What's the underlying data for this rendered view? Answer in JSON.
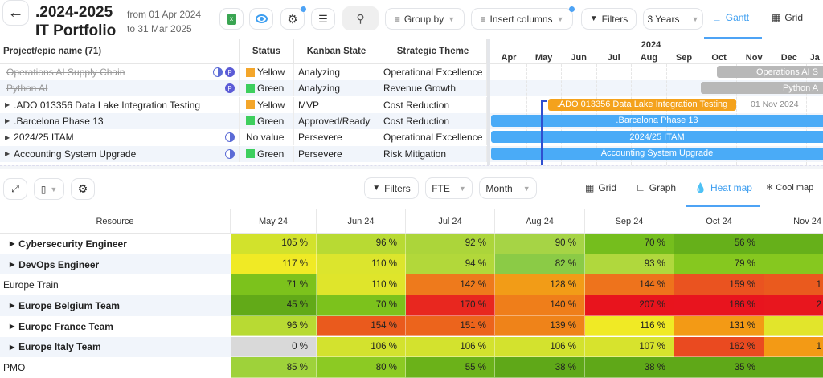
{
  "header": {
    "title_line1": ".2024-2025",
    "title_line2": "IT Portfolio",
    "date_from": "from 01 Apr 2024",
    "date_to": "to 31 Mar 2025"
  },
  "toolbar": {
    "group_by": "Group by",
    "insert_columns": "Insert columns",
    "filters": "Filters",
    "range": "3 Years",
    "tab_gantt": "Gantt",
    "tab_grid": "Grid"
  },
  "grid": {
    "columns": [
      "Project/epic name (71)",
      "Status",
      "Kanban State",
      "Strategic Theme"
    ],
    "rows": [
      {
        "name": "Operations AI Supply Chain",
        "struck": true,
        "expand": false,
        "icons": [
          "half-circle",
          "P"
        ],
        "status": "Yellow",
        "status_color": "#f4a62a",
        "kanban": "Analyzing",
        "theme": "Operational Excellence"
      },
      {
        "name": "Python AI",
        "struck": true,
        "expand": false,
        "icons": [
          "P"
        ],
        "status": "Green",
        "status_color": "#3ecf5e",
        "kanban": "Analyzing",
        "theme": "Revenue Growth"
      },
      {
        "name": ".ADO 013356 Data Lake Integration Testing",
        "struck": false,
        "expand": true,
        "icons": [],
        "status": "Yellow",
        "status_color": "#f4a62a",
        "kanban": "MVP",
        "theme": "Cost Reduction"
      },
      {
        "name": ".Barcelona Phase 13",
        "struck": false,
        "expand": true,
        "icons": [],
        "status": "Green",
        "status_color": "#3ecf5e",
        "kanban": "Approved/Ready",
        "theme": "Cost Reduction"
      },
      {
        "name": "2024/25 ITAM",
        "struck": false,
        "expand": true,
        "icons": [
          "half-circle"
        ],
        "status": "No value",
        "status_color": "",
        "kanban": "Persevere",
        "theme": "Operational Excellence"
      },
      {
        "name": "Accounting System Upgrade",
        "struck": false,
        "expand": true,
        "icons": [
          "half-circle"
        ],
        "status": "Green",
        "status_color": "#3ecf5e",
        "kanban": "Persevere",
        "theme": "Risk Mitigation"
      }
    ]
  },
  "gantt": {
    "year": "2024",
    "months": [
      "Apr",
      "May",
      "Jun",
      "Jul",
      "Aug",
      "Sep",
      "Oct",
      "Nov",
      "Dec",
      "Ja"
    ],
    "bars": [
      {
        "label": "Operations AI S",
        "color": "#b8b8b8",
        "start": "Oct",
        "row": 0
      },
      {
        "label": "Python A",
        "color": "#b8b8b8",
        "start": "Oct",
        "row": 1
      },
      {
        "label": ".ADO 013356 Data Lake Integration Testing",
        "color": "#f4a21c",
        "row": 2,
        "end_date": "01 Nov 2024"
      },
      {
        "label": ".Barcelona Phase 13",
        "color": "#4aabf7",
        "row": 3
      },
      {
        "label": "2024/25 ITAM",
        "color": "#4aabf7",
        "row": 4
      },
      {
        "label": "Accounting System Upgrade",
        "color": "#4aabf7",
        "row": 5
      }
    ]
  },
  "heatmap_toolbar": {
    "filters": "Filters",
    "unit": "FTE",
    "period": "Month",
    "tab_grid": "Grid",
    "tab_graph": "Graph",
    "tab_heatmap": "Heat map",
    "tab_coolmap": "Cool map"
  },
  "heatmap": {
    "resource_header": "Resource",
    "months": [
      "May 24",
      "Jun 24",
      "Jul 24",
      "Aug 24",
      "Sep 24",
      "Oct 24",
      "Nov 24"
    ],
    "rows": [
      {
        "name": "Cybersecurity Engineer",
        "expand": true,
        "bold": true,
        "values": [
          "105 %",
          "96 %",
          "92 %",
          "90 %",
          "70 %",
          "56 %",
          ""
        ],
        "colors": [
          "#d2e22c",
          "#b8da33",
          "#acd53a",
          "#a6d445",
          "#75be1d",
          "#66b01a",
          "#66b01a"
        ]
      },
      {
        "name": "DevOps Engineer",
        "expand": true,
        "bold": true,
        "values": [
          "117 %",
          "110 %",
          "94 %",
          "82 %",
          "93 %",
          "79 %",
          ""
        ],
        "colors": [
          "#f0ea25",
          "#dce52d",
          "#b2d83a",
          "#8bcb46",
          "#b0d83d",
          "#86c81f",
          "#86c81f"
        ]
      },
      {
        "name": "Europe Train",
        "expand": false,
        "bold": false,
        "values": [
          "71 %",
          "110 %",
          "142 %",
          "128 %",
          "144 %",
          "159 %",
          "1"
        ],
        "colors": [
          "#7cc21c",
          "#dfe52b",
          "#ee7a1c",
          "#f29c17",
          "#ee731c",
          "#ea5320",
          "#ea5a1e"
        ]
      },
      {
        "name": "Europe Belgium Team",
        "expand": true,
        "bold": true,
        "values": [
          "45 %",
          "70 %",
          "170 %",
          "140 %",
          "207 %",
          "186 %",
          "2"
        ],
        "colors": [
          "#62aa18",
          "#7cc21c",
          "#e8271f",
          "#ef7e1a",
          "#e8141d",
          "#e8141e",
          "#e8161e"
        ]
      },
      {
        "name": "Europe France Team",
        "expand": true,
        "bold": true,
        "values": [
          "96 %",
          "154 %",
          "151 %",
          "139 %",
          "116 %",
          "131 %",
          ""
        ],
        "colors": [
          "#b8da33",
          "#ea5a1d",
          "#ec641c",
          "#ef8319",
          "#f0ea25",
          "#f39a15",
          "#e2e52b"
        ]
      },
      {
        "name": "Europe Italy Team",
        "expand": true,
        "bold": true,
        "values": [
          "0 %",
          "106 %",
          "106 %",
          "106 %",
          "107 %",
          "162 %",
          "1"
        ],
        "colors": [
          "#d9d9d9",
          "#d3e22e",
          "#d3e22e",
          "#d3e22e",
          "#d7e32d",
          "#ea4a20",
          "#f39a15"
        ]
      },
      {
        "name": "PMO",
        "expand": false,
        "bold": false,
        "values": [
          "85 %",
          "80 %",
          "55 %",
          "38 %",
          "38 %",
          "35 %",
          ""
        ],
        "colors": [
          "#9ed23a",
          "#8cca23",
          "#6bb219",
          "#5fa818",
          "#5fa818",
          "#5fa818",
          "#5fa818"
        ]
      }
    ]
  }
}
